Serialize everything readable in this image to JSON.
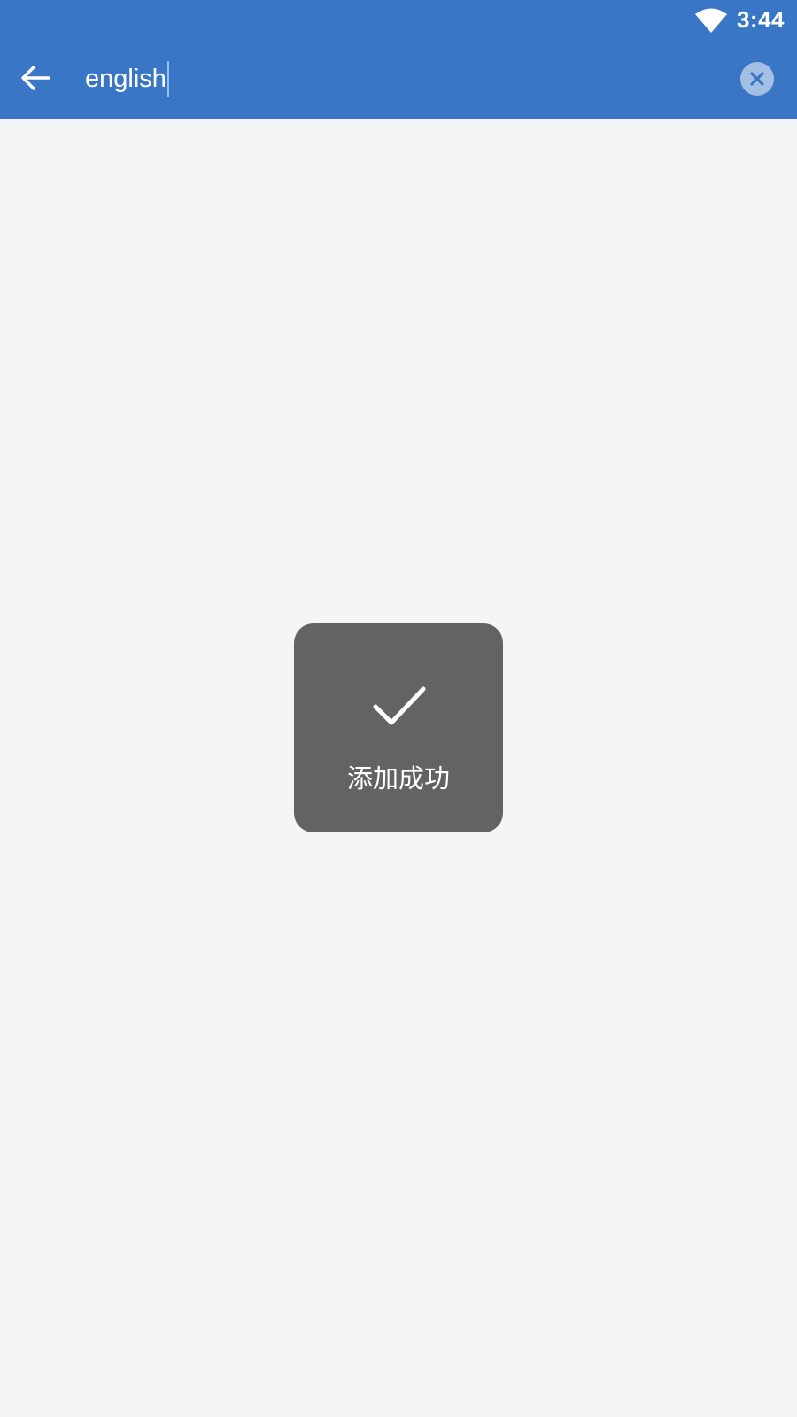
{
  "status_bar": {
    "time": "3:44",
    "wifi_icon": "wifi-icon"
  },
  "toolbar": {
    "back_icon": "arrow-left-icon",
    "search_value": "english",
    "clear_icon": "clear-circle-icon"
  },
  "toast": {
    "icon": "checkmark-icon",
    "message": "添加成功"
  },
  "colors": {
    "header": "#3a76c6",
    "background": "#f4f5f7",
    "toast": "#636363"
  }
}
